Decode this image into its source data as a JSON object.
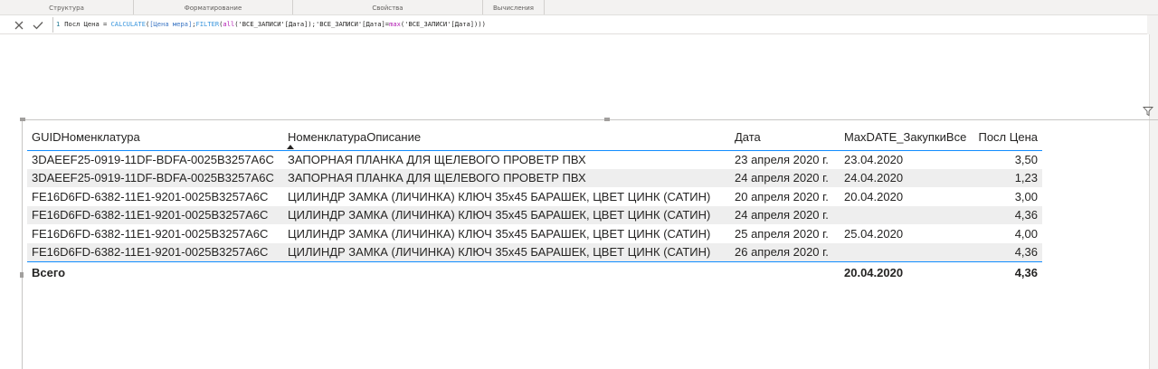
{
  "ribbon": {
    "groups": [
      "Структура",
      "Форматирование",
      "Свойства",
      "Вычисления"
    ]
  },
  "formula_bar": {
    "line_number": "1",
    "measure_name": "Посл Цена = ",
    "fn_calculate": "CALCULATE",
    "paren_open": "(",
    "ref_measure": "[Цена мера]",
    "sep1": ";",
    "fn_filter": "FILTER",
    "paren2": "(",
    "fn_all": "all",
    "arg_all": "('ВСЕ_ЗАПИСИ'[Дата])",
    "sep2": ";",
    "cond_left": "'ВСЕ_ЗАПИСИ'[Дата]=",
    "fn_max": "max",
    "arg_max": "('ВСЕ_ЗАПИСИ'[Дата])",
    "closing": "))",
    "cancel_icon": "close-icon",
    "commit_icon": "check-icon"
  },
  "table": {
    "headers": [
      "GUIDНоменклатура",
      "НоменклатураОписание",
      "Дата",
      "MaxDATE_ЗакупкиВсе",
      "Посл Цена"
    ],
    "rows": [
      [
        "3DAEEF25-0919-11DF-BDFA-0025B3257A6C",
        "ЗАПОРНАЯ ПЛАНКА ДЛЯ ЩЕЛЕВОГО ПРОВЕТР ПВХ",
        "23 апреля 2020 г.",
        "23.04.2020",
        "3,50"
      ],
      [
        "3DAEEF25-0919-11DF-BDFA-0025B3257A6C",
        "ЗАПОРНАЯ ПЛАНКА ДЛЯ ЩЕЛЕВОГО ПРОВЕТР ПВХ",
        "24 апреля 2020 г.",
        "24.04.2020",
        "1,23"
      ],
      [
        "FE16D6FD-6382-11E1-9201-0025B3257A6C",
        "ЦИЛИНДР ЗАМКА (ЛИЧИНКА) КЛЮЧ 35x45 БАРАШЕК, ЦВЕТ ЦИНК (САТИН)",
        "20 апреля 2020 г.",
        "20.04.2020",
        "3,00"
      ],
      [
        "FE16D6FD-6382-11E1-9201-0025B3257A6C",
        "ЦИЛИНДР ЗАМКА (ЛИЧИНКА) КЛЮЧ 35x45 БАРАШЕК, ЦВЕТ ЦИНК (САТИН)",
        "24 апреля 2020 г.",
        "",
        "4,36"
      ],
      [
        "FE16D6FD-6382-11E1-9201-0025B3257A6C",
        "ЦИЛИНДР ЗАМКА (ЛИЧИНКА) КЛЮЧ 35x45 БАРАШЕК, ЦВЕТ ЦИНК (САТИН)",
        "25 апреля 2020 г.",
        "25.04.2020",
        "4,00"
      ],
      [
        "FE16D6FD-6382-11E1-9201-0025B3257A6C",
        "ЦИЛИНДР ЗАМКА (ЛИЧИНКА) КЛЮЧ 35x45 БАРАШЕК, ЦВЕТ ЦИНК (САТИН)",
        "26 апреля 2020 г.",
        "",
        "4,36"
      ]
    ],
    "total": {
      "label": "Всего",
      "maxdate": "20.04.2020",
      "price": "4,36"
    },
    "sorted_column": "НоменклатураОписание",
    "sort_direction": "ascending"
  },
  "colors": {
    "accent": "#118dff",
    "row_alt": "#eeeeee"
  },
  "icons": {
    "filter": "filter-icon"
  }
}
